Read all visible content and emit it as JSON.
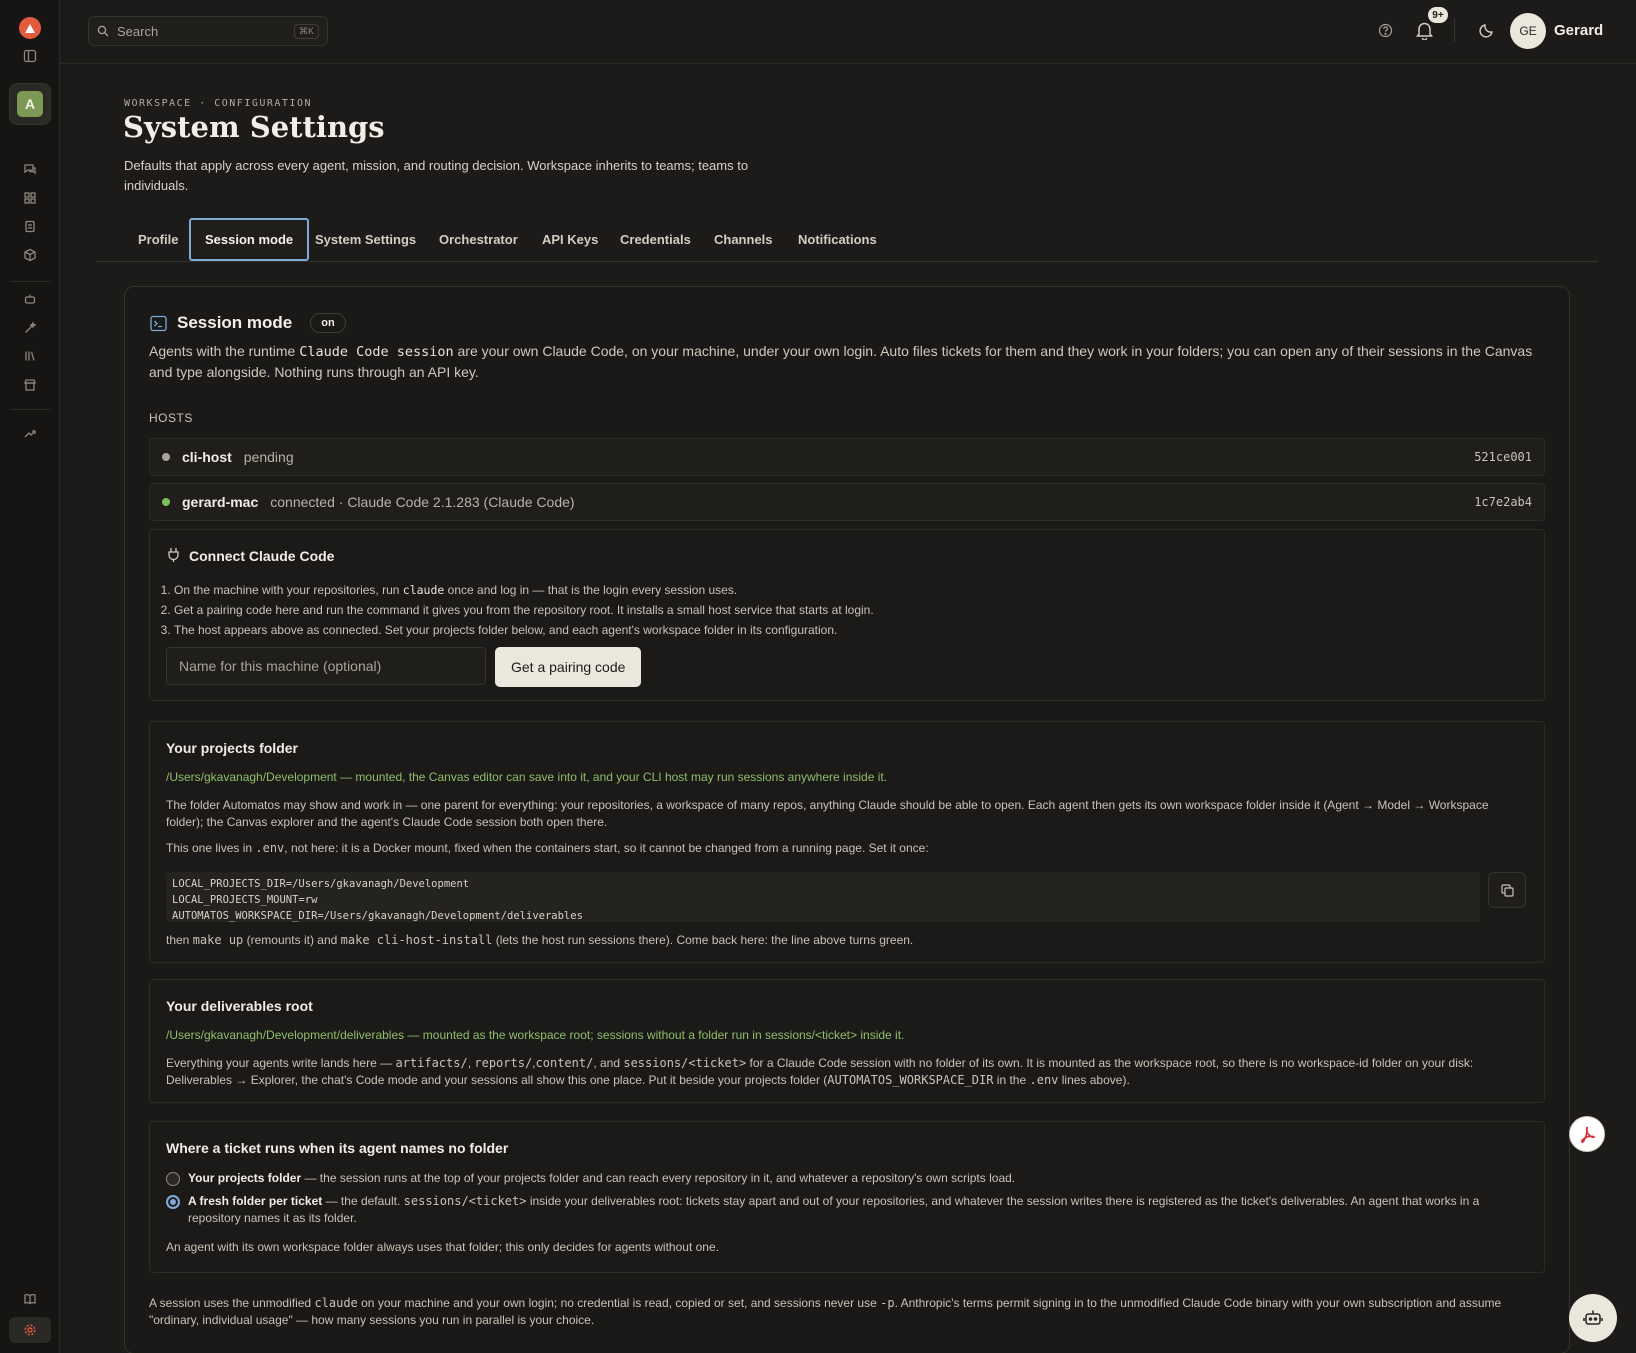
{
  "topbar": {
    "search_placeholder": "Search",
    "search_shortcut": "⌘K",
    "notifications_badge": "9+",
    "user_initials": "GE",
    "user_name": "Gerard"
  },
  "header": {
    "eyebrow": "WORKSPACE · CONFIGURATION",
    "title": "System Settings",
    "subtitle": "Defaults that apply across every agent, mission, and routing decision. Workspace inherits to teams; teams to individuals."
  },
  "tabs": [
    "Profile",
    "Session mode",
    "System Settings",
    "Orchestrator",
    "API Keys",
    "Credentials",
    "Channels",
    "Notifications"
  ],
  "active_tab": "Session mode",
  "session": {
    "title": "Session mode",
    "state_pill": "on",
    "desc_1": "Agents with the runtime ",
    "desc_code": "Claude Code session",
    "desc_2": " are your own Claude Code, on your machine, under your own login. Auto files tickets for them and they work in your folders; you can open any of their sessions in the Canvas and type alongside. Nothing runs through an API key.",
    "hosts_label": "HOSTS",
    "hosts": [
      {
        "name": "cli-host",
        "status": "pending",
        "id": "521ce001",
        "dot_color": "#a9a398"
      },
      {
        "name": "gerard-mac",
        "status": "connected · Claude Code 2.1.283 (Claude Code)",
        "id": "1c7e2ab4",
        "dot_color": "#7cbf5a"
      }
    ]
  },
  "connect": {
    "title": "Connect Claude Code",
    "step1_a": "On the machine with your repositories, run ",
    "step1_code": "claude",
    "step1_b": " once and log in — that is the login every session uses.",
    "step2": "Get a pairing code here and run the command it gives you from the repository root. It installs a small host service that starts at login.",
    "step3": "The host appears above as connected. Set your projects folder below, and each agent's workspace folder in its configuration.",
    "machine_placeholder": "Name for this machine (optional)",
    "pair_button": "Get a pairing code"
  },
  "projects": {
    "title": "Your projects folder",
    "status": "/Users/gkavanagh/Development — mounted, the Canvas editor can save into it, and your CLI host may run sessions anywhere inside it.",
    "para1": "The folder Automatos may show and work in — one parent for everything: your repositories, a workspace of many repos, anything Claude should be able to open. Each agent then gets its own workspace folder inside it (Agent → Model → Workspace folder); the Canvas explorer and the agent's Claude Code session both open there.",
    "para2_a": "This one lives in ",
    "para2_code": ".env",
    "para2_b": ", not here: it is a Docker mount, fixed when the containers start, so it cannot be changed from a running page. Set it once:",
    "code_lines": [
      "LOCAL_PROJECTS_DIR=/Users/gkavanagh/Development",
      "LOCAL_PROJECTS_MOUNT=rw",
      "AUTOMATOS_WORKSPACE_DIR=/Users/gkavanagh/Development/deliverables"
    ],
    "after_a": "then ",
    "after_code1": "make up",
    "after_b": " (remounts it) and ",
    "after_code2": "make cli-host-install",
    "after_c": " (lets the host run sessions there). Come back here: the line above turns green."
  },
  "deliverables": {
    "title": "Your deliverables root",
    "status": "/Users/gkavanagh/Development/deliverables — mounted as the workspace root; sessions without a folder run in sessions/<ticket> inside it.",
    "p_a": "Everything your agents write lands here — ",
    "p_c1": "artifacts/",
    "p_s1": ", ",
    "p_c2": "reports/",
    "p_s2": ",",
    "p_c3": "content/",
    "p_s3": ", and ",
    "p_c4": "sessions/<ticket>",
    "p_b": " for a Claude Code session with no folder of its own. It is mounted as the workspace root, so there is no workspace-id folder on your disk: Deliverables → Explorer, the chat's Code mode and your sessions all show this one place. Put it beside your projects folder (",
    "p_c5": "AUTOMATOS_WORKSPACE_DIR",
    "p_s5": " in the ",
    "p_c6": ".env",
    "p_e": " lines above)."
  },
  "ticket_folder": {
    "title": "Where a ticket runs when its agent names no folder",
    "opt1_label": "Your projects folder",
    "opt1_desc": " — the session runs at the top of your projects folder and can reach every repository in it, and whatever a repository's own scripts load.",
    "opt2_label": "A fresh folder per ticket",
    "opt2_a": " — the default. ",
    "opt2_code": "sessions/<ticket>",
    "opt2_b": " inside your deliverables root: tickets stay apart and out of your repositories, and whatever the session writes there is registered as the ticket's deliverables. An agent that works in a repository names it as its folder.",
    "note": "An agent with its own workspace folder always uses that folder; this only decides for agents without one."
  },
  "footer": {
    "a": "A session uses the unmodified ",
    "code1": "claude",
    "b": " on your machine and your own login; no credential is read, copied or set, and sessions never use ",
    "code2": "-p",
    "c": ". Anthropic's terms permit signing in to the unmodified Claude Code binary with your own subscription and assume \"ordinary, individual usage\" — how many sessions you run in parallel is your choice."
  }
}
